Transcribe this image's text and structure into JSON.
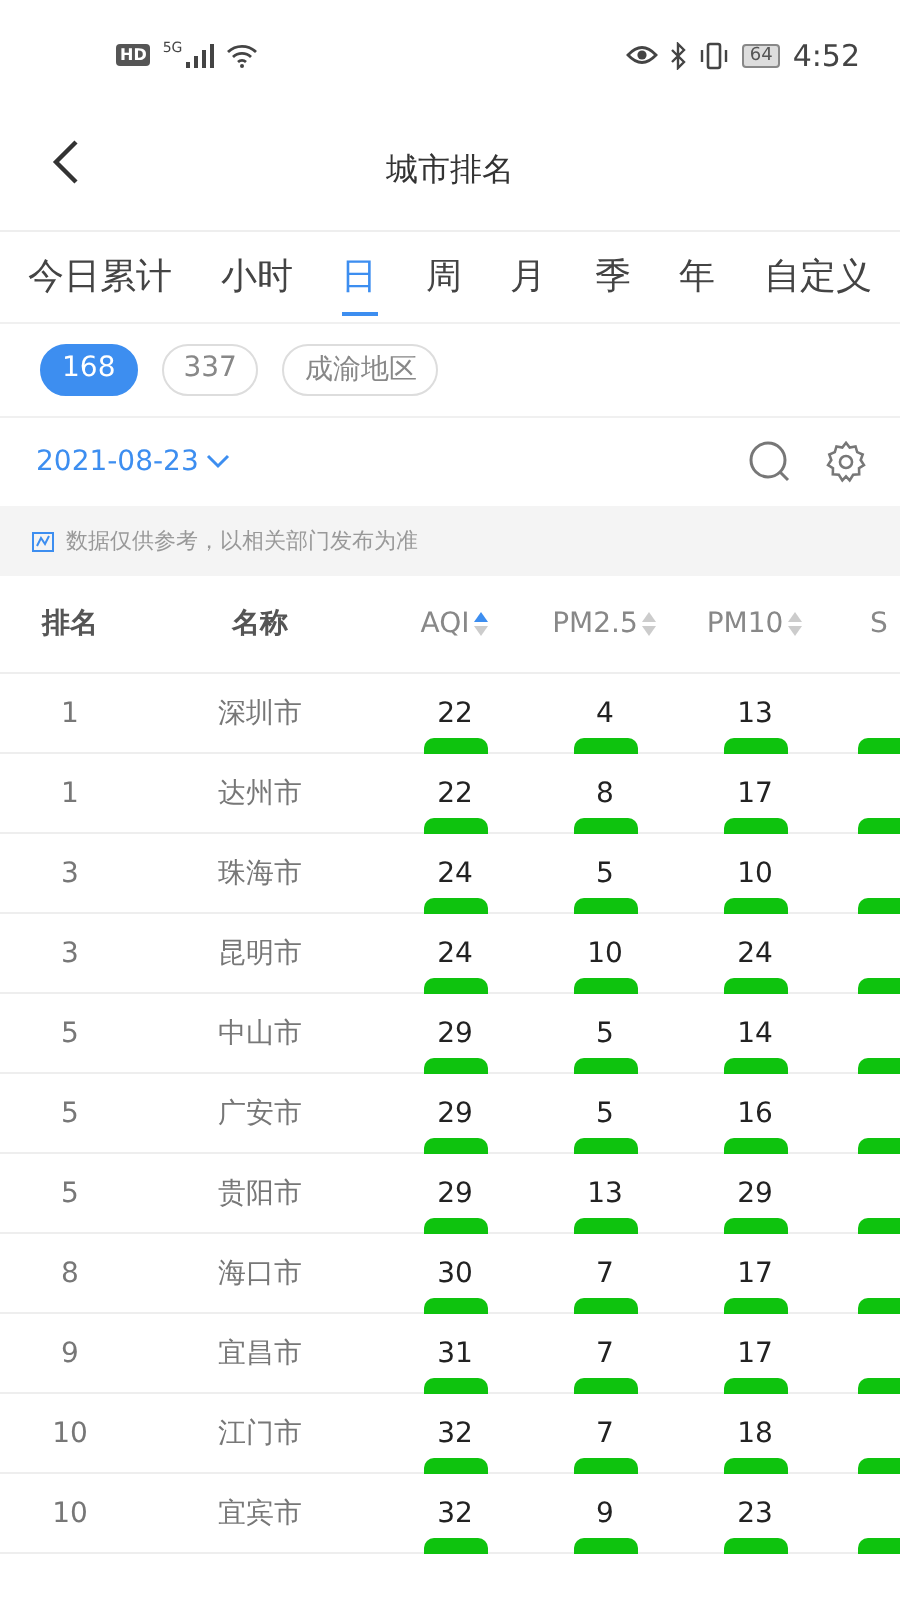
{
  "status_bar": {
    "hd": "HD",
    "network": "5G",
    "battery": "64",
    "time": "4:52"
  },
  "header": {
    "title": "城市排名"
  },
  "tabs": [
    {
      "label": "今日累计",
      "selected": false
    },
    {
      "label": "小时",
      "selected": false
    },
    {
      "label": "日",
      "selected": true
    },
    {
      "label": "周",
      "selected": false
    },
    {
      "label": "月",
      "selected": false
    },
    {
      "label": "季",
      "selected": false
    },
    {
      "label": "年",
      "selected": false
    },
    {
      "label": "自定义",
      "selected": false
    }
  ],
  "chips": [
    {
      "label": "168",
      "selected": true
    },
    {
      "label": "337",
      "selected": false
    },
    {
      "label": "成渝地区",
      "selected": false
    }
  ],
  "date": "2021-08-23",
  "notice": "数据仅供参考，以相关部门发布为准",
  "table": {
    "columns": [
      {
        "label": "排名",
        "kind": "plain"
      },
      {
        "label": "名称",
        "kind": "plain"
      },
      {
        "label": "AQI",
        "kind": "sort",
        "sort_ascending": true
      },
      {
        "label": "PM2.5",
        "kind": "sort",
        "sort_ascending": false
      },
      {
        "label": "PM10",
        "kind": "sort",
        "sort_ascending": false
      },
      {
        "label": "S",
        "kind": "cut"
      }
    ],
    "rows": [
      {
        "cells": [
          {
            "value": "1"
          },
          {
            "value": "深圳市"
          },
          {
            "value": "22",
            "color": "#0ec30e"
          },
          {
            "value": "4",
            "color": "#0ec30e"
          },
          {
            "value": "13",
            "color": "#0ec30e"
          },
          {
            "color": "#0ec30e"
          }
        ]
      },
      {
        "cells": [
          {
            "value": "1"
          },
          {
            "value": "达州市"
          },
          {
            "value": "22",
            "color": "#0ec30e"
          },
          {
            "value": "8",
            "color": "#0ec30e"
          },
          {
            "value": "17",
            "color": "#0ec30e"
          },
          {
            "color": "#0ec30e"
          }
        ]
      },
      {
        "cells": [
          {
            "value": "3"
          },
          {
            "value": "珠海市"
          },
          {
            "value": "24",
            "color": "#0ec30e"
          },
          {
            "value": "5",
            "color": "#0ec30e"
          },
          {
            "value": "10",
            "color": "#0ec30e"
          },
          {
            "color": "#0ec30e"
          }
        ]
      },
      {
        "cells": [
          {
            "value": "3"
          },
          {
            "value": "昆明市"
          },
          {
            "value": "24",
            "color": "#0ec30e"
          },
          {
            "value": "10",
            "color": "#0ec30e"
          },
          {
            "value": "24",
            "color": "#0ec30e"
          },
          {
            "color": "#0ec30e"
          }
        ]
      },
      {
        "cells": [
          {
            "value": "5"
          },
          {
            "value": "中山市"
          },
          {
            "value": "29",
            "color": "#0ec30e"
          },
          {
            "value": "5",
            "color": "#0ec30e"
          },
          {
            "value": "14",
            "color": "#0ec30e"
          },
          {
            "color": "#0ec30e"
          }
        ]
      },
      {
        "cells": [
          {
            "value": "5"
          },
          {
            "value": "广安市"
          },
          {
            "value": "29",
            "color": "#0ec30e"
          },
          {
            "value": "5",
            "color": "#0ec30e"
          },
          {
            "value": "16",
            "color": "#0ec30e"
          },
          {
            "color": "#0ec30e"
          }
        ]
      },
      {
        "cells": [
          {
            "value": "5"
          },
          {
            "value": "贵阳市"
          },
          {
            "value": "29",
            "color": "#0ec30e"
          },
          {
            "value": "13",
            "color": "#0ec30e"
          },
          {
            "value": "29",
            "color": "#0ec30e"
          },
          {
            "color": "#0ec30e"
          }
        ]
      },
      {
        "cells": [
          {
            "value": "8"
          },
          {
            "value": "海口市"
          },
          {
            "value": "30",
            "color": "#0ec30e"
          },
          {
            "value": "7",
            "color": "#0ec30e"
          },
          {
            "value": "17",
            "color": "#0ec30e"
          },
          {
            "color": "#0ec30e"
          }
        ]
      },
      {
        "cells": [
          {
            "value": "9"
          },
          {
            "value": "宜昌市"
          },
          {
            "value": "31",
            "color": "#0ec30e"
          },
          {
            "value": "7",
            "color": "#0ec30e"
          },
          {
            "value": "17",
            "color": "#0ec30e"
          },
          {
            "color": "#0ec30e"
          }
        ]
      },
      {
        "cells": [
          {
            "value": "10"
          },
          {
            "value": "江门市"
          },
          {
            "value": "32",
            "color": "#0ec30e"
          },
          {
            "value": "7",
            "color": "#0ec30e"
          },
          {
            "value": "18",
            "color": "#0ec30e"
          },
          {
            "color": "#0ec30e"
          }
        ]
      },
      {
        "cells": [
          {
            "value": "10"
          },
          {
            "value": "宜宾市"
          },
          {
            "value": "32",
            "color": "#0ec30e"
          },
          {
            "value": "9",
            "color": "#0ec30e"
          },
          {
            "value": "23",
            "color": "#0ec30e"
          },
          {
            "color": "#0ec30e"
          }
        ]
      }
    ]
  }
}
